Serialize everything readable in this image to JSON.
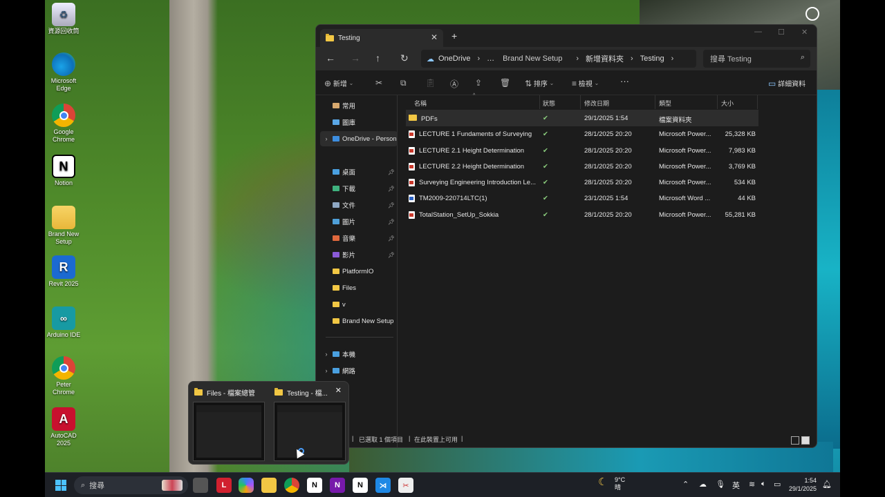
{
  "desktop": {
    "icons": [
      {
        "label": "資源回收筒",
        "icon": "recycle-bin-icon"
      },
      {
        "label": "Microsoft Edge",
        "icon": "edge-icon"
      },
      {
        "label": "Google Chrome",
        "icon": "chrome-icon"
      },
      {
        "label": "Notion",
        "icon": "notion-icon"
      },
      {
        "label": "Brand New Setup",
        "icon": "folder-icon"
      },
      {
        "label": "Revit 2025",
        "icon": "revit-icon"
      },
      {
        "label": "Arduino IDE",
        "icon": "arduino-icon"
      },
      {
        "label": "Peter Chrome",
        "icon": "chrome-icon"
      },
      {
        "label": "AutoCAD 2025",
        "icon": "autocad-icon"
      }
    ]
  },
  "explorer": {
    "tab_title": "Testing",
    "breadcrumb": [
      "OneDrive",
      "…",
      "Brand New Setup",
      "新增資料夾",
      "Testing"
    ],
    "search_placeholder": "搜尋 Testing",
    "commands": {
      "new": "新增",
      "sort": "排序",
      "view": "檢視",
      "more": "···",
      "details": "詳細資料"
    },
    "sidebar": {
      "home": "常用",
      "gallery": "圖庫",
      "onedrive": "OneDrive - Person",
      "desktop": "桌面",
      "downloads": "下載",
      "documents": "文件",
      "pictures": "圖片",
      "music": "音樂",
      "videos": "影片",
      "platformio": "PlatformIO",
      "files": "Files",
      "v": "v",
      "brand_new_setup": "Brand New Setup",
      "this_pc": "本機",
      "network": "網路"
    },
    "columns": [
      "名稱",
      "狀態",
      "修改日期",
      "類型",
      "大小"
    ],
    "files": [
      {
        "name": "PDFs",
        "kind": "folder",
        "status": "✔",
        "date": "29/1/2025 1:54",
        "type": "檔案資料夾",
        "size": ""
      },
      {
        "name": "LECTURE 1 Fundaments of Surveying",
        "kind": "ppt",
        "status": "✔",
        "date": "28/1/2025 20:20",
        "type": "Microsoft Power...",
        "size": "25,328 KB"
      },
      {
        "name": "LECTURE 2.1 Height Determination",
        "kind": "ppt",
        "status": "✔",
        "date": "28/1/2025 20:20",
        "type": "Microsoft Power...",
        "size": "7,983 KB"
      },
      {
        "name": "LECTURE 2.2 Height Determination",
        "kind": "ppt",
        "status": "✔",
        "date": "28/1/2025 20:20",
        "type": "Microsoft Power...",
        "size": "3,769 KB"
      },
      {
        "name": "Surveying Engineering Introduction Le...",
        "kind": "ppt",
        "status": "✔",
        "date": "28/1/2025 20:20",
        "type": "Microsoft Power...",
        "size": "534 KB"
      },
      {
        "name": "TM2009-220714LTC(1)",
        "kind": "doc",
        "status": "✔",
        "date": "23/1/2025 1:54",
        "type": "Microsoft Word ...",
        "size": "44 KB"
      },
      {
        "name": "TotalStation_SetUp_Sokkia",
        "kind": "ppt",
        "status": "✔",
        "date": "28/1/2025 20:20",
        "type": "Microsoft Power...",
        "size": "55,281 KB"
      }
    ],
    "status": {
      "selected": "已選取 1 個項目",
      "available": "在此裝置上可用"
    }
  },
  "thumbnail_popup": {
    "items": [
      {
        "title": "Files - 檔案總管"
      },
      {
        "title": "Testing - 檔..."
      }
    ]
  },
  "taskbar": {
    "search_label": "搜尋",
    "weather_temp": "9°C",
    "weather_desc": "晴",
    "ime": "英",
    "time": "1:54",
    "date": "29/1/2025"
  },
  "colors": {
    "window_bg": "#1c1c1c",
    "folder": "#f2c744",
    "synced": "#8ccf7e",
    "taskbar": "#1d2026"
  }
}
